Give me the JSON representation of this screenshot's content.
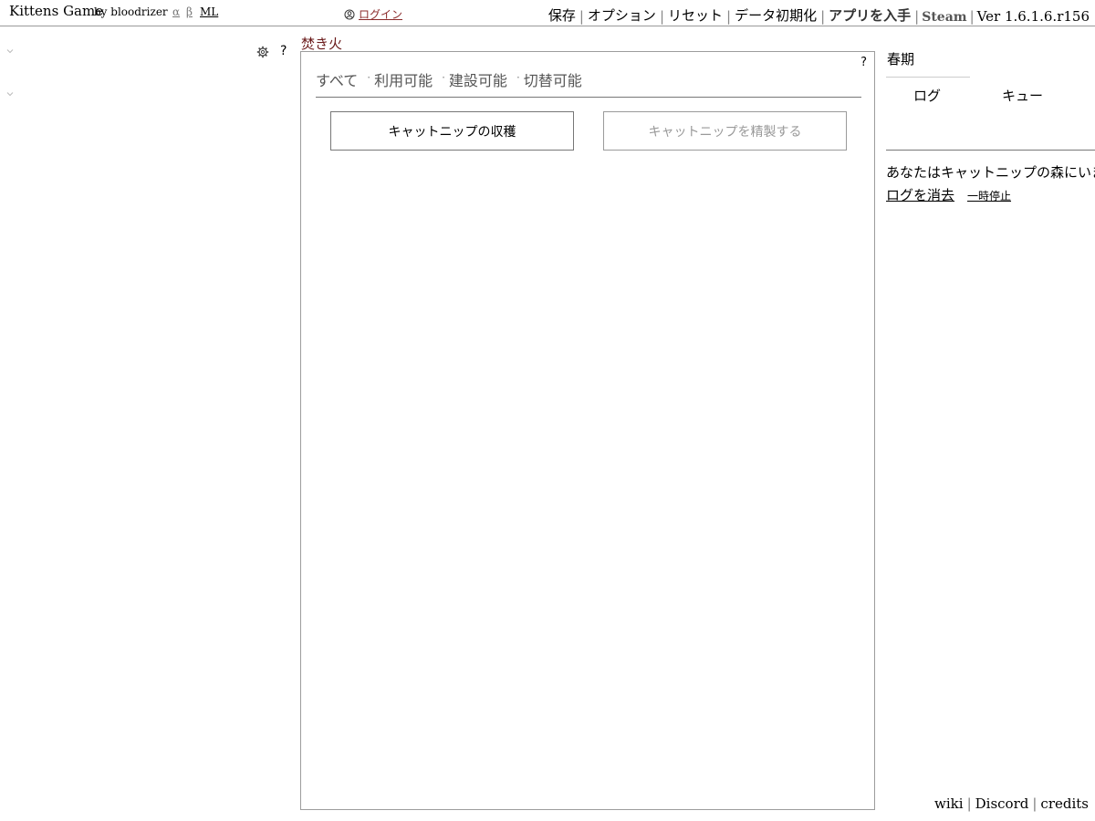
{
  "header": {
    "title": "Kittens Game",
    "author": "by bloodrizer",
    "version_links": [
      "α",
      "β",
      "ML"
    ],
    "login_label": "ログイン",
    "menu": {
      "save": "保存",
      "options": "オプション",
      "reset": "リセット",
      "wipe": "データ初期化",
      "get_app": "アプリを入手",
      "steam": "Steam",
      "version": "Ver 1.6.1.6.r156"
    }
  },
  "left": {
    "help": "?"
  },
  "center": {
    "section_title": "焚き火",
    "help": "?",
    "filters": [
      "すべて",
      "利用可能",
      "建設可能",
      "切替可能"
    ],
    "filter_separator": "·",
    "buttons": {
      "gather": "キャットニップの収穫",
      "refine": "キャットニップを精製する"
    }
  },
  "right": {
    "season": "春期",
    "tabs": {
      "log": "ログ",
      "queue": "キュー"
    },
    "log_message": "あなたはキャットニップの森にいます。",
    "clear_log": "ログを消去",
    "pause": "一時停止"
  },
  "footer": {
    "links": [
      "wiki",
      "Discord",
      "credits"
    ],
    "separator": "|"
  },
  "colors": {
    "section_title": "#6a1a1a",
    "login_link": "#8b2b2b",
    "disabled_text": "#999999",
    "border": "#9c9c9c"
  },
  "icons": [
    "user-circle-icon",
    "chevron-down-icon",
    "gear-icon"
  ]
}
